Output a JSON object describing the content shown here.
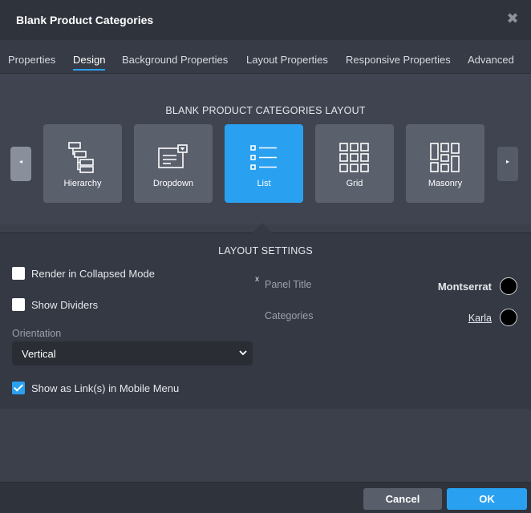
{
  "dialog": {
    "title": "Blank Product Categories"
  },
  "tabs": [
    {
      "label": "Properties",
      "active": false
    },
    {
      "label": "Design",
      "active": true
    },
    {
      "label": "Background Properties",
      "active": false
    },
    {
      "label": "Layout Properties",
      "active": false
    },
    {
      "label": "Responsive Properties",
      "active": false
    },
    {
      "label": "Advanced",
      "active": false
    }
  ],
  "layout_section": {
    "heading": "BLANK PRODUCT CATEGORIES LAYOUT",
    "options": [
      {
        "label": "Hierarchy",
        "icon": "hierarchy-icon",
        "selected": false
      },
      {
        "label": "Dropdown",
        "icon": "dropdown-icon",
        "selected": false
      },
      {
        "label": "List",
        "icon": "list-icon",
        "selected": true
      },
      {
        "label": "Grid",
        "icon": "grid-icon",
        "selected": false
      },
      {
        "label": "Masonry",
        "icon": "masonry-icon",
        "selected": false
      }
    ],
    "prev_icon": "◂",
    "next_icon": "▸"
  },
  "settings": {
    "heading": "LAYOUT SETTINGS",
    "render_collapsed": {
      "label": "Render in Collapsed Mode",
      "checked": false
    },
    "show_dividers": {
      "label": "Show Dividers",
      "checked": false
    },
    "orientation": {
      "label": "Orientation",
      "value": "Vertical"
    },
    "mobile_links": {
      "label": "Show as Link(s) in Mobile Menu",
      "checked": true
    },
    "clear_badge": "x",
    "panel_title": {
      "label": "Panel Title",
      "font": "Montserrat",
      "color": "#000000"
    },
    "categories": {
      "label": "Categories",
      "font": "Karla",
      "color": "#000000"
    }
  },
  "footer": {
    "cancel_label": "Cancel",
    "ok_label": "OK"
  },
  "colors": {
    "accent": "#2aa1f0",
    "background": "#3b404b",
    "panel": "#353944"
  }
}
